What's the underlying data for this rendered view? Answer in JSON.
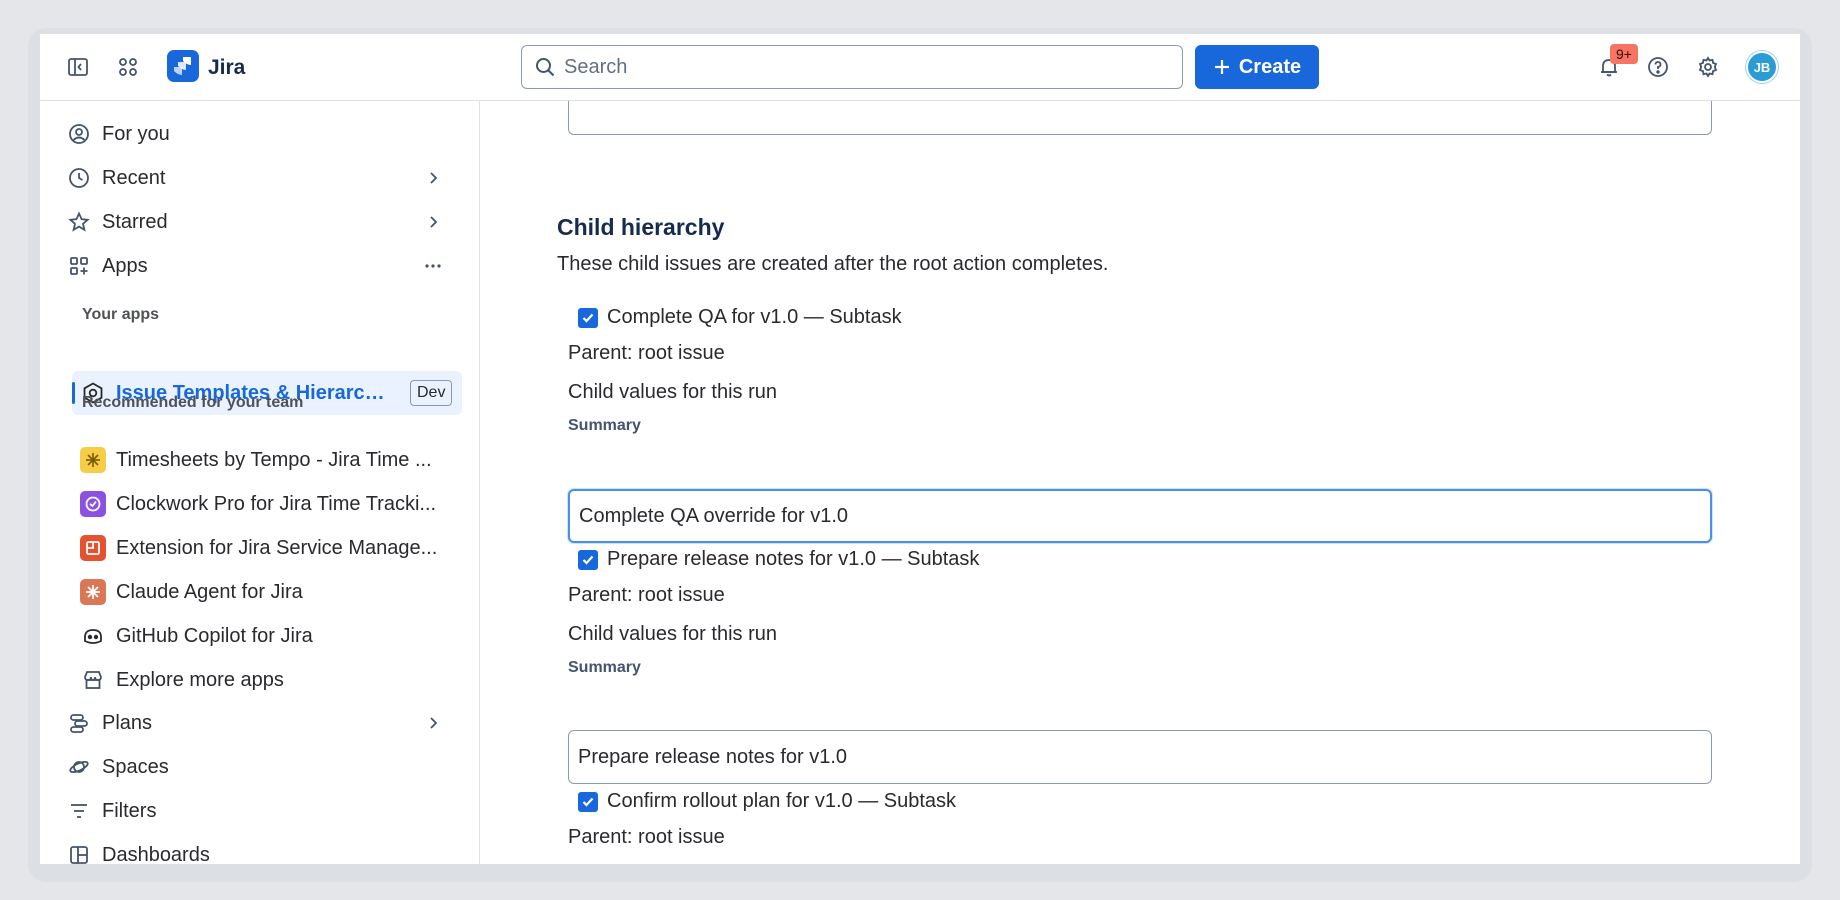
{
  "topbar": {
    "app_name": "Jira",
    "search_placeholder": "Search",
    "create_label": "Create",
    "notifications_badge": "9+",
    "avatar_initials": "JB"
  },
  "sidebar": {
    "nav_top": [
      {
        "label": "For you",
        "icon": "person-circle-icon"
      },
      {
        "label": "Recent",
        "icon": "clock-icon"
      },
      {
        "label": "Starred",
        "icon": "star-icon"
      },
      {
        "label": "Apps",
        "icon": "apps-icon"
      }
    ],
    "your_apps_label": "Your apps",
    "selected_app": {
      "label": "Issue Templates & Hierarch...",
      "badge": "Dev"
    },
    "recommended_label": "Recommended for your team",
    "recommended_apps": [
      {
        "label": "Timesheets by Tempo - Jira Time ...",
        "color": "#f5cd47"
      },
      {
        "label": "Clockwork Pro for Jira Time Tracki...",
        "color": "#8b52e0"
      },
      {
        "label": "Extension for Jira Service Manage...",
        "color": "#e5522f"
      },
      {
        "label": "Claude Agent for Jira",
        "color": "#d97757"
      },
      {
        "label": "GitHub Copilot for Jira",
        "color": "#ffffff"
      },
      {
        "label": "Explore more apps",
        "color": "#ffffff"
      }
    ],
    "nav_bottom": [
      {
        "label": "Plans",
        "icon": "plans-icon"
      },
      {
        "label": "Spaces",
        "icon": "spaces-icon"
      },
      {
        "label": "Filters",
        "icon": "filter-icon"
      },
      {
        "label": "Dashboards",
        "icon": "dashboard-icon"
      }
    ]
  },
  "main": {
    "section_title": "Child hierarchy",
    "section_desc": "These child issues are created after the root action completes.",
    "children": [
      {
        "title": "Complete QA for v1.0 — Subtask",
        "parent": "Parent: root issue",
        "values_label": "Child values for this run",
        "summary_label": "Summary",
        "summary_value": "Complete QA override for v1.0"
      },
      {
        "title": "Prepare release notes for v1.0 — Subtask",
        "parent": "Parent: root issue",
        "values_label": "Child values for this run",
        "summary_label": "Summary",
        "summary_value": "Prepare release notes for v1.0"
      },
      {
        "title": "Confirm rollout plan for v1.0 — Subtask",
        "parent": "Parent: root issue"
      }
    ]
  },
  "colors": {
    "brand": "#1868db",
    "selected_bg": "#e9f2fe"
  }
}
